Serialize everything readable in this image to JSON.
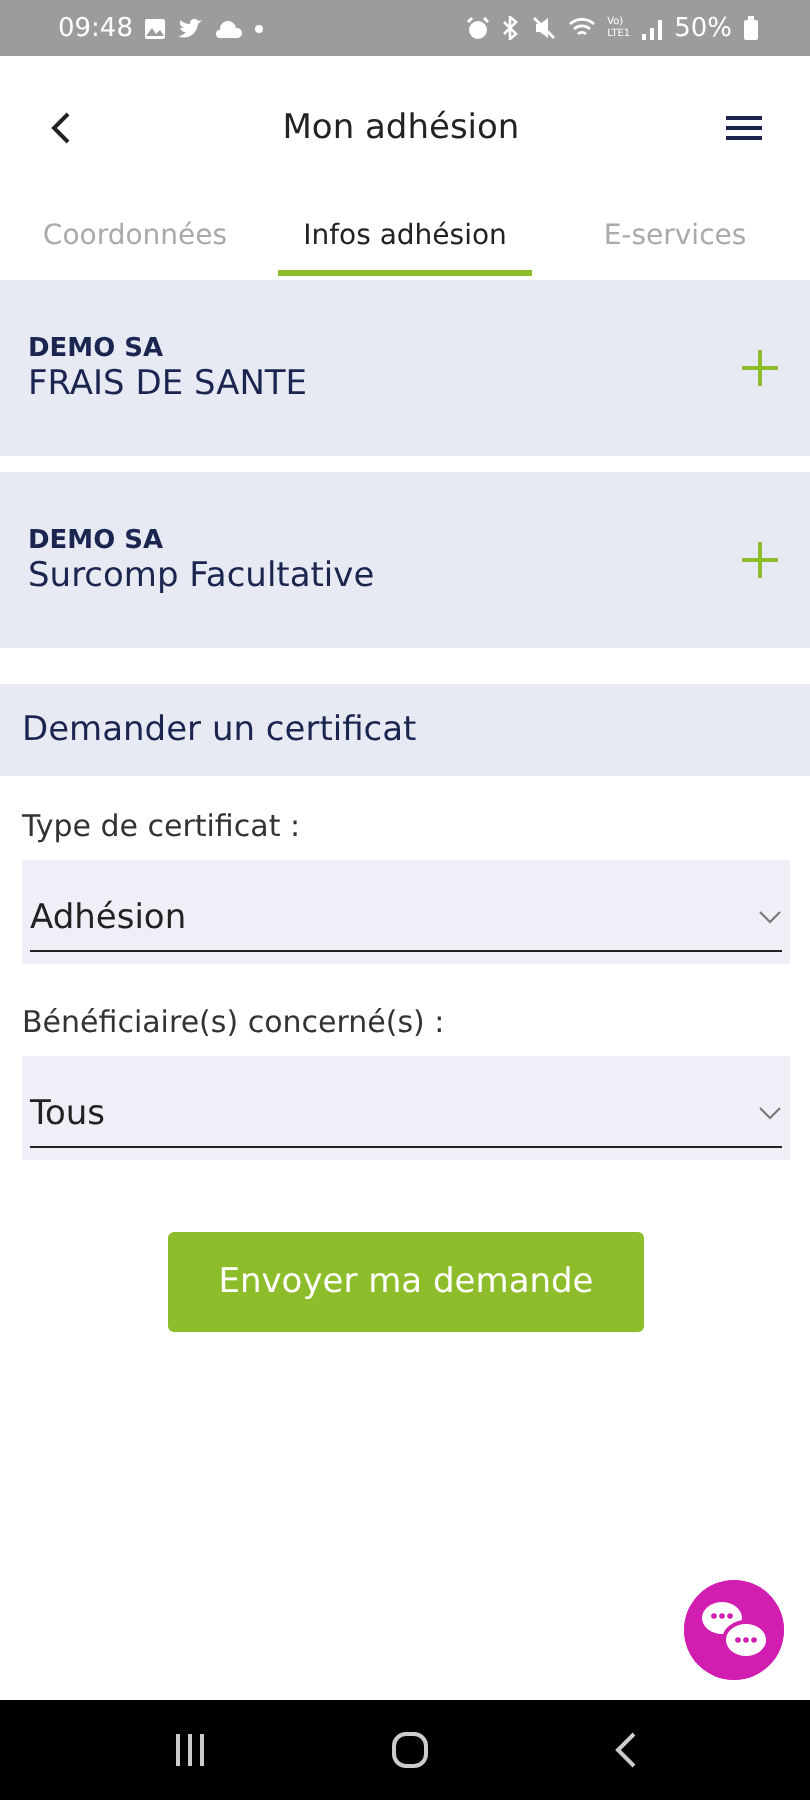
{
  "status_bar": {
    "time": "09:48",
    "network_top": "Vo)",
    "network_bottom": "LTE1",
    "battery": "50%"
  },
  "header": {
    "title": "Mon adhésion"
  },
  "tabs": [
    {
      "label": "Coordonnées",
      "selected": false
    },
    {
      "label": "Infos adhésion",
      "selected": true
    },
    {
      "label": "E-services",
      "selected": false
    }
  ],
  "contracts": [
    {
      "company": "DEMO SA",
      "name": "FRAIS DE SANTE",
      "expanded": false
    },
    {
      "company": "DEMO SA",
      "name": "Surcomp Facultative",
      "expanded": false
    }
  ],
  "certificate": {
    "title": "Demander un certificat",
    "fields": [
      {
        "label": "Type de certificat :",
        "value": "Adhésion"
      },
      {
        "label": "Bénéficiaire(s) concerné(s) :",
        "value": "Tous"
      }
    ],
    "button": "Envoyer ma demande"
  }
}
